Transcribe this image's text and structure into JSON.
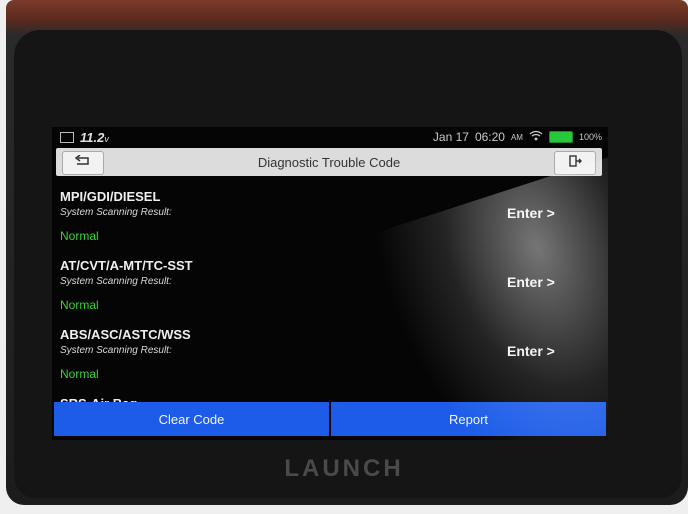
{
  "status_bar": {
    "voltage": "11.2",
    "voltage_unit": "v",
    "date": "Jan 17",
    "time": "06:20",
    "meridiem": "AM",
    "battery": "100%"
  },
  "header": {
    "title": "Diagnostic Trouble Code"
  },
  "systems": [
    {
      "name": "MPI/GDI/DIESEL",
      "subtitle": "System Scanning Result:",
      "status": "Normal",
      "action": "Enter >"
    },
    {
      "name": "AT/CVT/A-MT/TC-SST",
      "subtitle": "System Scanning Result:",
      "status": "Normal",
      "action": "Enter >"
    },
    {
      "name": "ABS/ASC/ASTC/WSS",
      "subtitle": "System Scanning Result:",
      "status": "Normal",
      "action": "Enter >"
    }
  ],
  "partial_item": "SRS-Air Bag",
  "footer": {
    "clear_code": "Clear Code",
    "report": "Report"
  },
  "device": {
    "brand": "LAUNCH"
  },
  "colors": {
    "accent_blue": "#1c5ce8",
    "status_green": "#3ad03a",
    "battery_green": "#28c83a"
  },
  "icons": {
    "back": "back-arrow-icon",
    "exit": "exit-icon",
    "wifi": "wifi-icon",
    "battery": "battery-icon",
    "calendar": "calendar-icon"
  }
}
